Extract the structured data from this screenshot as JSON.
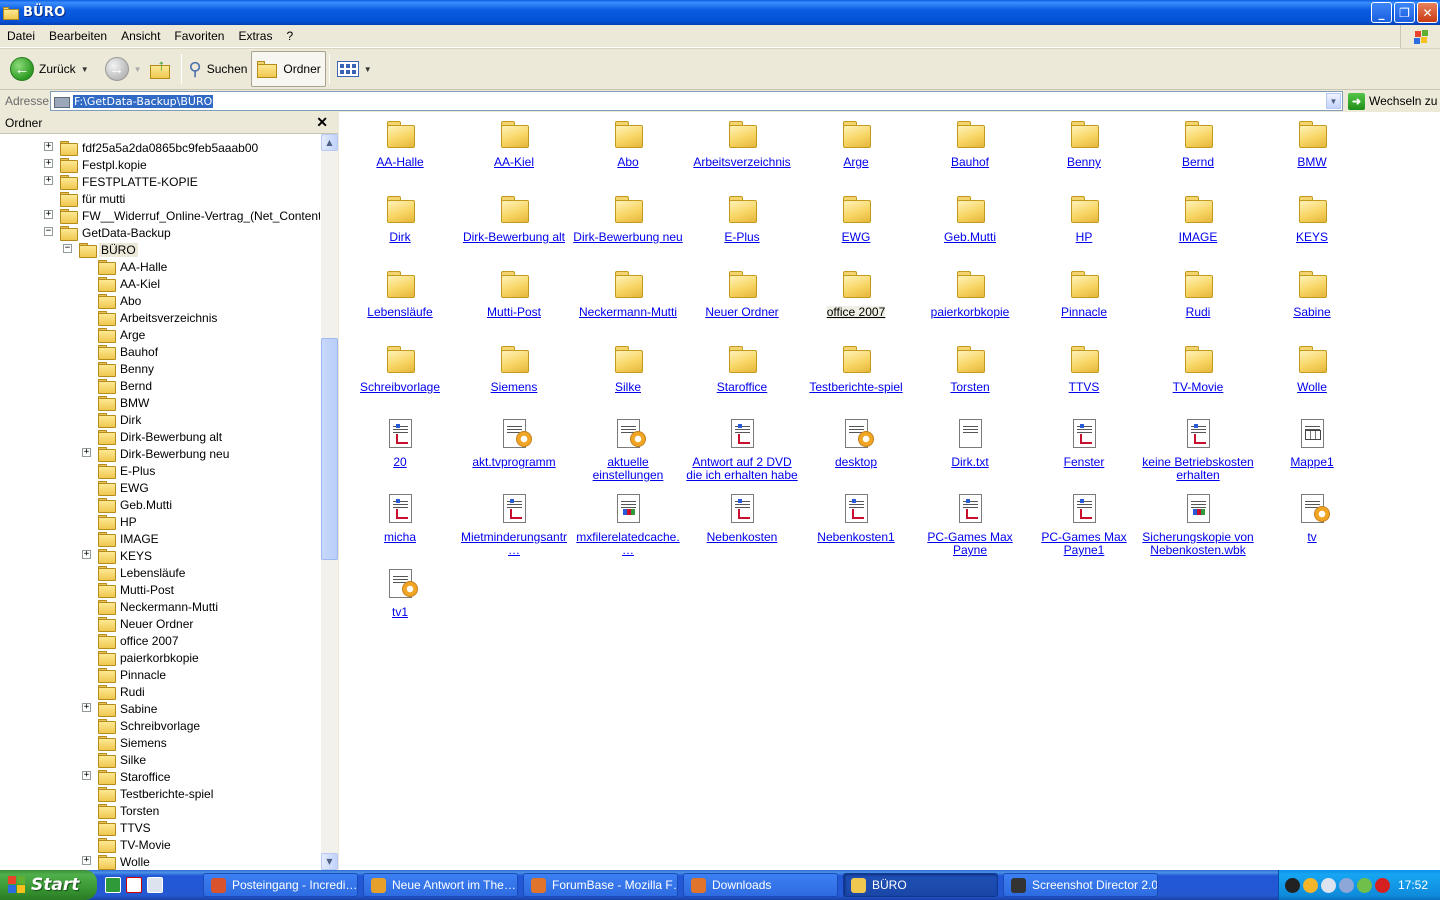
{
  "window": {
    "title": "BÜRO"
  },
  "menu": [
    "Datei",
    "Bearbeiten",
    "Ansicht",
    "Favoriten",
    "Extras",
    "?"
  ],
  "toolbar": {
    "back": "Zurück",
    "search": "Suchen",
    "folders": "Ordner"
  },
  "address": {
    "label": "Adresse",
    "value": "F:\\GetData-Backup\\BÜRO",
    "go": "Wechseln zu"
  },
  "folderpane": {
    "title": "Ordner",
    "tree": [
      {
        "label": "fdf25a5a2da0865bc9feb5aaab00",
        "level": 0,
        "expander": "+"
      },
      {
        "label": "Festpl.kopie",
        "level": 0,
        "expander": "+"
      },
      {
        "label": "FESTPLATTE-KOPIE",
        "level": 0,
        "expander": "+"
      },
      {
        "label": "für mutti",
        "level": 0,
        "expander": ""
      },
      {
        "label": "FW__Widerruf_Online-Vertrag_(Net_Content)",
        "level": 0,
        "expander": "+"
      },
      {
        "label": "GetData-Backup",
        "level": 0,
        "expander": "-"
      },
      {
        "label": "BÜRO",
        "level": 1,
        "expander": "-",
        "selected": true
      },
      {
        "label": "AA-Halle",
        "level": 2,
        "expander": ""
      },
      {
        "label": "AA-Kiel",
        "level": 2,
        "expander": ""
      },
      {
        "label": "Abo",
        "level": 2,
        "expander": ""
      },
      {
        "label": "Arbeitsverzeichnis",
        "level": 2,
        "expander": ""
      },
      {
        "label": "Arge",
        "level": 2,
        "expander": ""
      },
      {
        "label": "Bauhof",
        "level": 2,
        "expander": ""
      },
      {
        "label": "Benny",
        "level": 2,
        "expander": ""
      },
      {
        "label": "Bernd",
        "level": 2,
        "expander": ""
      },
      {
        "label": "BMW",
        "level": 2,
        "expander": ""
      },
      {
        "label": "Dirk",
        "level": 2,
        "expander": ""
      },
      {
        "label": "Dirk-Bewerbung alt",
        "level": 2,
        "expander": ""
      },
      {
        "label": "Dirk-Bewerbung neu",
        "level": 2,
        "expander": "+"
      },
      {
        "label": "E-Plus",
        "level": 2,
        "expander": ""
      },
      {
        "label": "EWG",
        "level": 2,
        "expander": ""
      },
      {
        "label": "Geb.Mutti",
        "level": 2,
        "expander": ""
      },
      {
        "label": "HP",
        "level": 2,
        "expander": ""
      },
      {
        "label": "IMAGE",
        "level": 2,
        "expander": ""
      },
      {
        "label": "KEYS",
        "level": 2,
        "expander": "+"
      },
      {
        "label": "Lebensläufe",
        "level": 2,
        "expander": ""
      },
      {
        "label": "Mutti-Post",
        "level": 2,
        "expander": ""
      },
      {
        "label": "Neckermann-Mutti",
        "level": 2,
        "expander": ""
      },
      {
        "label": "Neuer Ordner",
        "level": 2,
        "expander": ""
      },
      {
        "label": "office 2007",
        "level": 2,
        "expander": ""
      },
      {
        "label": "paierkorbkopie",
        "level": 2,
        "expander": ""
      },
      {
        "label": "Pinnacle",
        "level": 2,
        "expander": ""
      },
      {
        "label": "Rudi",
        "level": 2,
        "expander": ""
      },
      {
        "label": "Sabine",
        "level": 2,
        "expander": "+"
      },
      {
        "label": "Schreibvorlage",
        "level": 2,
        "expander": ""
      },
      {
        "label": "Siemens",
        "level": 2,
        "expander": ""
      },
      {
        "label": "Silke",
        "level": 2,
        "expander": ""
      },
      {
        "label": "Staroffice",
        "level": 2,
        "expander": "+"
      },
      {
        "label": "Testberichte-spiel",
        "level": 2,
        "expander": ""
      },
      {
        "label": "Torsten",
        "level": 2,
        "expander": ""
      },
      {
        "label": "TTVS",
        "level": 2,
        "expander": ""
      },
      {
        "label": "TV-Movie",
        "level": 2,
        "expander": ""
      },
      {
        "label": "Wolle",
        "level": 2,
        "expander": "+"
      }
    ]
  },
  "items": [
    {
      "label": "AA-Halle",
      "icon": "folder-icon"
    },
    {
      "label": "AA-Kiel",
      "icon": "folder-icon"
    },
    {
      "label": "Abo",
      "icon": "folder-icon"
    },
    {
      "label": "Arbeitsverzeichnis",
      "icon": "folder-icon"
    },
    {
      "label": "Arge",
      "icon": "folder-icon"
    },
    {
      "label": "Bauhof",
      "icon": "folder-icon"
    },
    {
      "label": "Benny",
      "icon": "folder-icon"
    },
    {
      "label": "Bernd",
      "icon": "folder-icon"
    },
    {
      "label": "BMW",
      "icon": "folder-icon"
    },
    {
      "label": "Dirk",
      "icon": "folder-icon"
    },
    {
      "label": "Dirk-Bewerbung alt",
      "icon": "folder-icon"
    },
    {
      "label": "Dirk-Bewerbung neu",
      "icon": "folder-icon"
    },
    {
      "label": "E-Plus",
      "icon": "folder-icon"
    },
    {
      "label": "EWG",
      "icon": "folder-icon"
    },
    {
      "label": "Geb.Mutti",
      "icon": "folder-icon"
    },
    {
      "label": "HP",
      "icon": "folder-icon"
    },
    {
      "label": "IMAGE",
      "icon": "folder-icon"
    },
    {
      "label": "KEYS",
      "icon": "folder-icon"
    },
    {
      "label": "Lebensläufe",
      "icon": "folder-icon"
    },
    {
      "label": "Mutti-Post",
      "icon": "folder-icon"
    },
    {
      "label": "Neckermann-Mutti",
      "icon": "folder-icon"
    },
    {
      "label": "Neuer Ordner",
      "icon": "folder-icon"
    },
    {
      "label": "office 2007",
      "icon": "folder-icon",
      "highlight": true
    },
    {
      "label": "paierkorbkopie",
      "icon": "folder-icon"
    },
    {
      "label": "Pinnacle",
      "icon": "folder-icon"
    },
    {
      "label": "Rudi",
      "icon": "folder-icon"
    },
    {
      "label": "Sabine",
      "icon": "folder-icon"
    },
    {
      "label": "Schreibvorlage",
      "icon": "folder-icon"
    },
    {
      "label": "Siemens",
      "icon": "folder-icon"
    },
    {
      "label": "Silke",
      "icon": "folder-icon"
    },
    {
      "label": "Staroffice",
      "icon": "folder-icon"
    },
    {
      "label": "Testberichte-spiel",
      "icon": "folder-icon"
    },
    {
      "label": "Torsten",
      "icon": "folder-icon"
    },
    {
      "label": "TTVS",
      "icon": "folder-icon"
    },
    {
      "label": "TV-Movie",
      "icon": "folder-icon"
    },
    {
      "label": "Wolle",
      "icon": "folder-icon"
    },
    {
      "label": "20",
      "icon": "pdf-document-icon"
    },
    {
      "label": "akt.tvprogramm",
      "icon": "settings-file-icon"
    },
    {
      "label": "aktuelle einstellungen",
      "icon": "settings-file-icon"
    },
    {
      "label": "Antwort auf 2 DVD die ich erhalten habe",
      "icon": "pdf-document-icon"
    },
    {
      "label": "desktop",
      "icon": "settings-file-icon"
    },
    {
      "label": "Dirk.txt",
      "icon": "text-file-icon"
    },
    {
      "label": "Fenster",
      "icon": "pdf-document-icon"
    },
    {
      "label": "keine Betriebskosten erhalten",
      "icon": "pdf-document-icon"
    },
    {
      "label": "Mappe1",
      "icon": "spreadsheet-icon"
    },
    {
      "label": "micha",
      "icon": "pdf-document-icon"
    },
    {
      "label": "Mietminderungsantr…",
      "icon": "pdf-document-icon"
    },
    {
      "label": "mxfilerelatedcache.…",
      "icon": "cache-file-icon"
    },
    {
      "label": "Nebenkosten",
      "icon": "pdf-document-icon"
    },
    {
      "label": "Nebenkosten1",
      "icon": "pdf-document-icon"
    },
    {
      "label": "PC-Games Max Payne",
      "icon": "pdf-document-icon"
    },
    {
      "label": "PC-Games Max Payne1",
      "icon": "pdf-document-icon"
    },
    {
      "label": "Sicherungskopie von Nebenkosten.wbk",
      "icon": "backup-file-icon"
    },
    {
      "label": "tv",
      "icon": "settings-file-icon"
    },
    {
      "label": "tv1",
      "icon": "settings-file-icon"
    }
  ],
  "taskbar": {
    "start": "Start",
    "tasks": [
      {
        "label": "Posteingang - Incredi…",
        "color": "#d9532c"
      },
      {
        "label": "Neue Antwort im The…",
        "color": "#e7a12a"
      },
      {
        "label": "ForumBase - Mozilla F…",
        "color": "#e0742a"
      },
      {
        "label": "Downloads",
        "color": "#e0742a"
      },
      {
        "label": "BÜRO",
        "color": "#f0c850",
        "active": true
      },
      {
        "label": "Screenshot Director 2.0",
        "color": "#333333"
      }
    ],
    "clock": "17:52"
  }
}
